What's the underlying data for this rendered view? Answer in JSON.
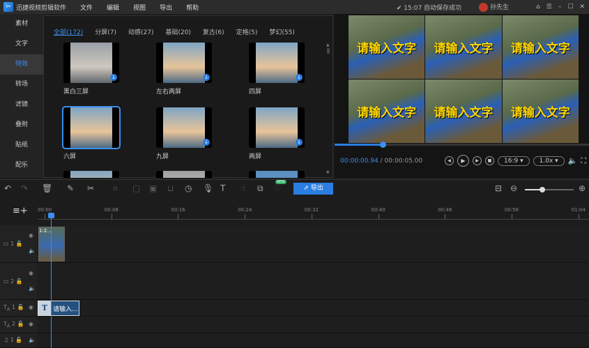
{
  "app": {
    "title": "迅捷视频剪辑软件",
    "menus": [
      "文件",
      "编辑",
      "视图",
      "导出",
      "帮助"
    ],
    "save_status": "15:07 自动保存成功",
    "user": "孙先生"
  },
  "sidebar": [
    "素材",
    "文字",
    "特效",
    "转场",
    "滤镜",
    "叠附",
    "贴纸",
    "配乐"
  ],
  "effects": {
    "tabs": [
      "全部(172)",
      "分屏(7)",
      "动感(27)",
      "基础(20)",
      "复古(6)",
      "定格(5)",
      "梦幻(55)"
    ],
    "items": [
      {
        "label": "黑白三屏",
        "download": true
      },
      {
        "label": "左右两屏",
        "download": true
      },
      {
        "label": "四屏",
        "download": true
      },
      {
        "label": "六屏",
        "download": false,
        "selected": true
      },
      {
        "label": "九屏",
        "download": true
      },
      {
        "label": "两屏",
        "download": true
      }
    ]
  },
  "preview": {
    "overlay_text": "请输入文字",
    "current_time": "00:00:00.94",
    "total_time": "00:00:05.00",
    "progress": 0.19,
    "aspect": "16:9",
    "speed": "1.0x"
  },
  "toolbar": {
    "export_label": "导出",
    "new_badge": "NEW",
    "zoom_level": 0.35
  },
  "ruler": [
    "00:00",
    "00:08",
    "00:16",
    "00:24",
    "00:32",
    "00:40",
    "00:48",
    "00:56",
    "01:04"
  ],
  "tracks": {
    "video_clip_label": "1:2...",
    "text_clip_label": "请输入...",
    "rows": [
      "1",
      "2",
      "1",
      "2",
      "1"
    ]
  }
}
